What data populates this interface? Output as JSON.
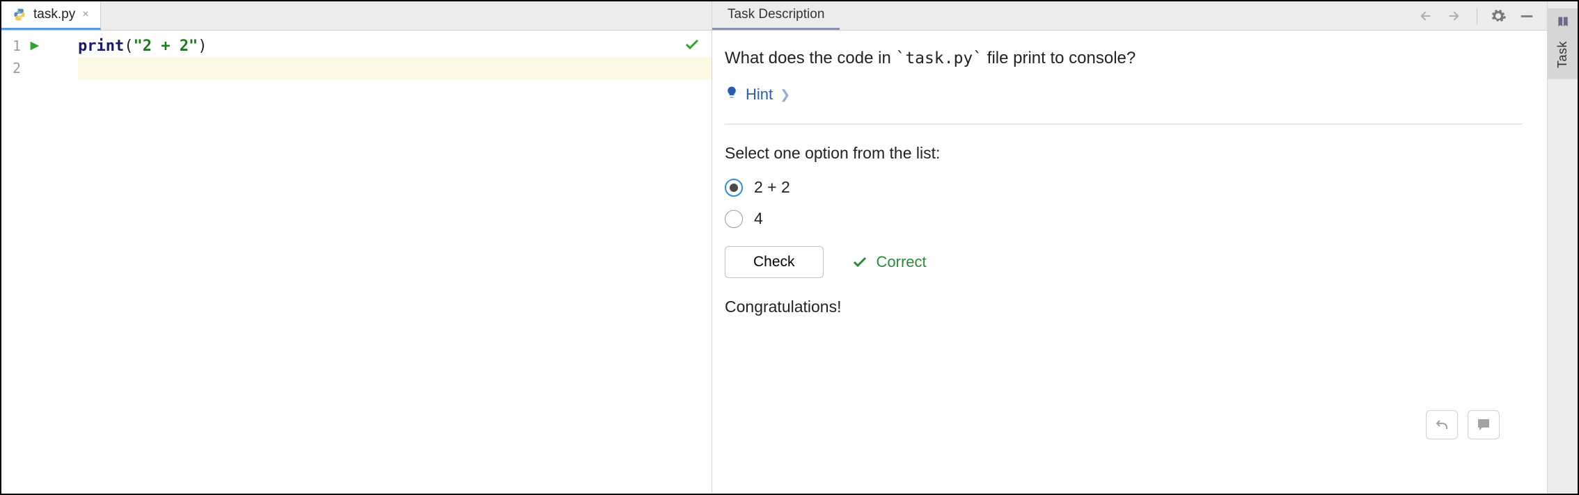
{
  "editor": {
    "tab_name": "task.py",
    "lines": [
      "1",
      "2"
    ],
    "code": {
      "fn": "print",
      "open": "(",
      "str": "\"2 + 2\"",
      "close": ")"
    }
  },
  "task": {
    "header_title": "Task Description",
    "question_prefix": "What does the code in ",
    "question_code": "`task.py`",
    "question_suffix": " file print to console?",
    "hint_label": "Hint",
    "select_label": "Select one option from the list:",
    "options": [
      {
        "label": "2 + 2",
        "selected": true
      },
      {
        "label": "4",
        "selected": false
      }
    ],
    "check_label": "Check",
    "result_label": "Correct",
    "congrats": "Congratulations!",
    "rail_label": "Task"
  }
}
